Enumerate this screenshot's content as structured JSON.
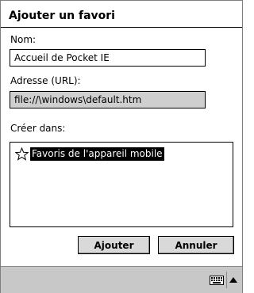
{
  "dialog": {
    "title": "Ajouter un favori"
  },
  "form": {
    "name_label": "Nom:",
    "name_value": "Accueil de Pocket IE",
    "url_label": "Adresse (URL):",
    "url_value": "file://\\windows\\default.htm",
    "create_in_label": "Créer dans:"
  },
  "folders": {
    "items": [
      {
        "label": "Favoris de l'appareil mobile",
        "icon": "star-icon",
        "selected": true
      }
    ]
  },
  "buttons": {
    "add_label": "Ajouter",
    "cancel_label": "Annuler"
  },
  "taskbar": {
    "icons": [
      "keyboard-icon",
      "sip-arrow-up-icon"
    ]
  },
  "colors": {
    "selection_bg": "#000000",
    "selection_fg": "#ffffff",
    "disabled_field_bg": "#cfcfcf",
    "button_bg": "#d9d9d9",
    "taskbar_bg": "#c8c8c8"
  }
}
